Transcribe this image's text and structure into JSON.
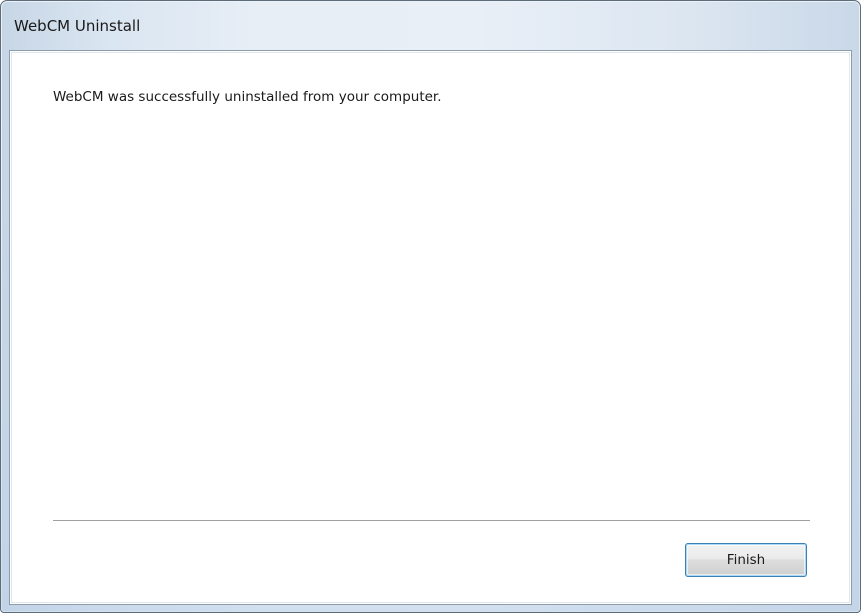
{
  "window": {
    "title": "WebCM Uninstall"
  },
  "content": {
    "message": "WebCM was successfully uninstalled from your computer."
  },
  "footer": {
    "finish_label": "Finish"
  },
  "colors": {
    "frame": "#d9e5f1",
    "frame_border": "#5e6b78",
    "button_focus_border": "#3c7fb1",
    "client_background": "#ffffff"
  }
}
